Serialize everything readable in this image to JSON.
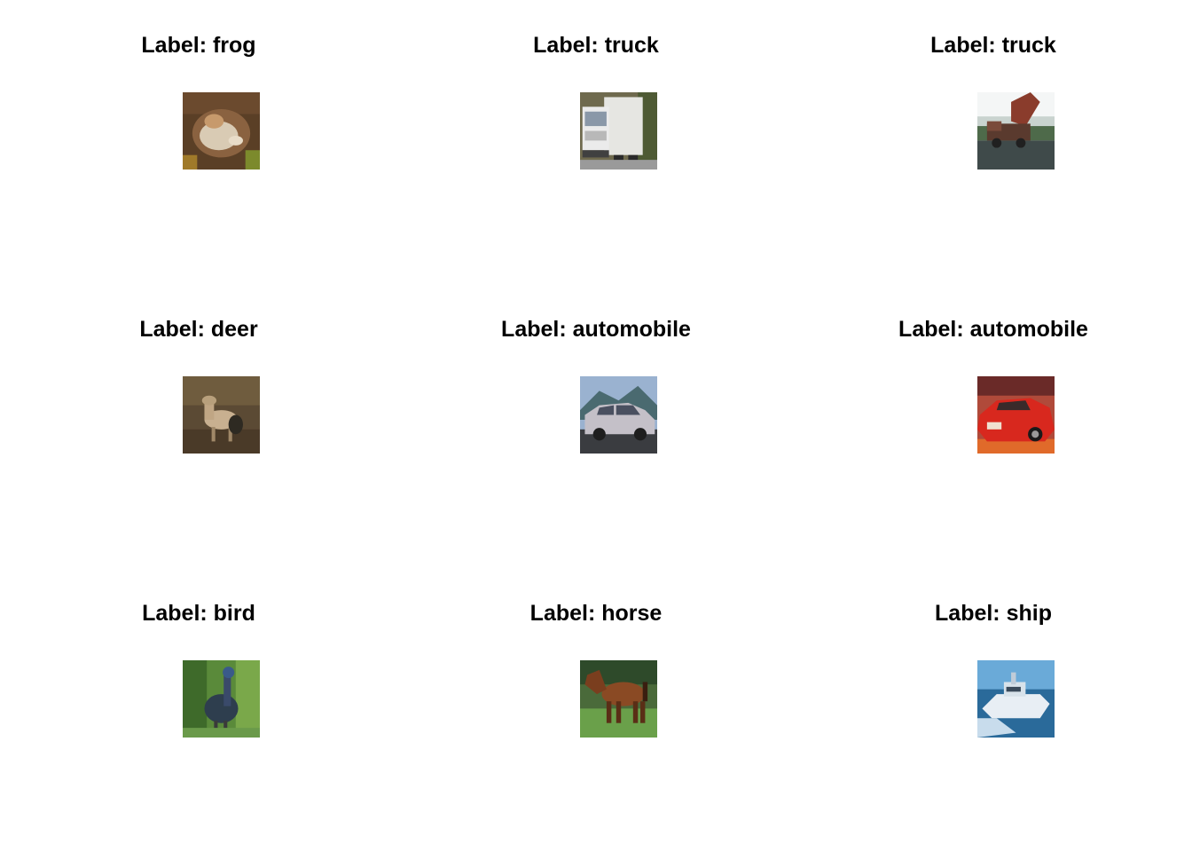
{
  "figure": {
    "panels": [
      {
        "title": "Label: frog",
        "image": "frog-photo"
      },
      {
        "title": "Label: truck",
        "image": "truck-photo"
      },
      {
        "title": "Label: truck",
        "image": "dump-truck-photo"
      },
      {
        "title": "Label: deer",
        "image": "deer-photo"
      },
      {
        "title": "Label: automobile",
        "image": "silver-car-photo"
      },
      {
        "title": "Label: automobile",
        "image": "red-car-photo"
      },
      {
        "title": "Label: bird",
        "image": "bird-photo"
      },
      {
        "title": "Label: horse",
        "image": "horse-photo"
      },
      {
        "title": "Label: ship",
        "image": "boat-photo"
      }
    ]
  }
}
